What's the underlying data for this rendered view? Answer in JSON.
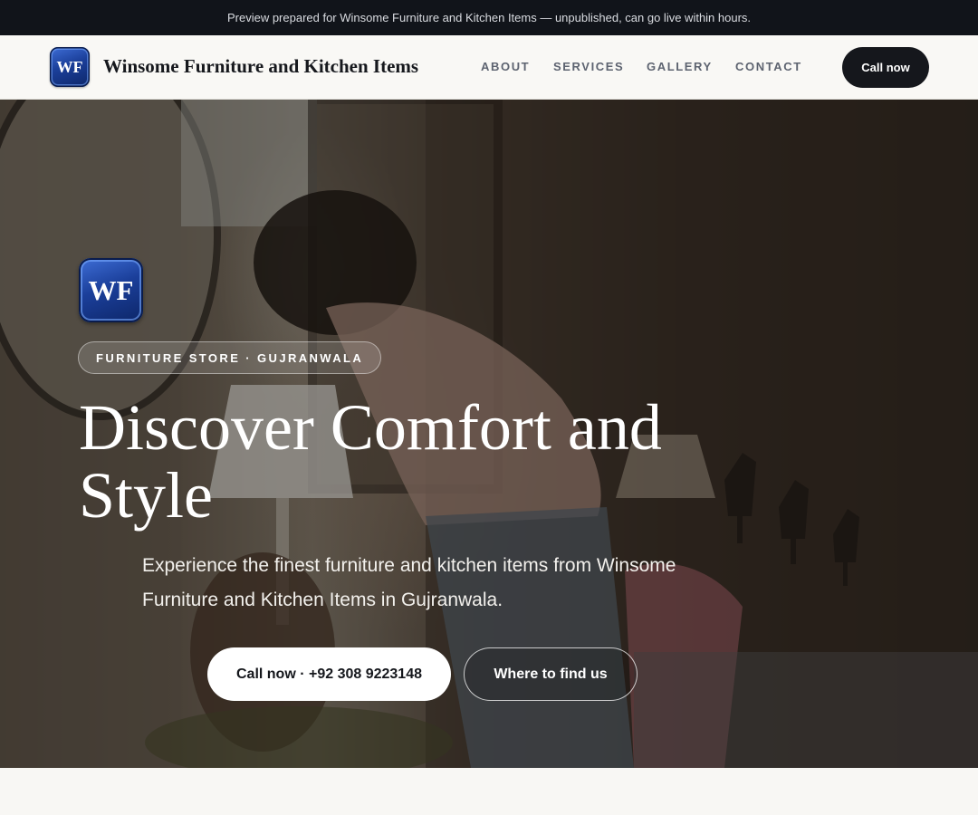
{
  "banner": {
    "text": "Preview prepared for Winsome Furniture and Kitchen Items — unpublished, can go live within hours."
  },
  "header": {
    "logo_text": "WF",
    "brand_name": "Winsome Furniture and Kitchen Items",
    "nav": {
      "about": "ABOUT",
      "services": "SERVICES",
      "gallery": "GALLERY",
      "contact": "CONTACT"
    },
    "call_label": "Call now"
  },
  "hero": {
    "badge_text": "WF",
    "eyebrow": "FURNITURE STORE · GUJRANWALA",
    "title": "Discover Comfort and Style",
    "subtitle": "Experience the finest furniture and kitchen items from Winsome Furniture and Kitchen Items in Gujranwala.",
    "primary_cta": "Call now · +92 308 9223148",
    "secondary_cta": "Where to find us"
  },
  "colors": {
    "banner_bg": "#11141a",
    "header_bg": "#f9f8f5",
    "primary_button": "#15171c",
    "badge_blue": "#1b3f9a",
    "page_bg": "#f8f7f4"
  }
}
